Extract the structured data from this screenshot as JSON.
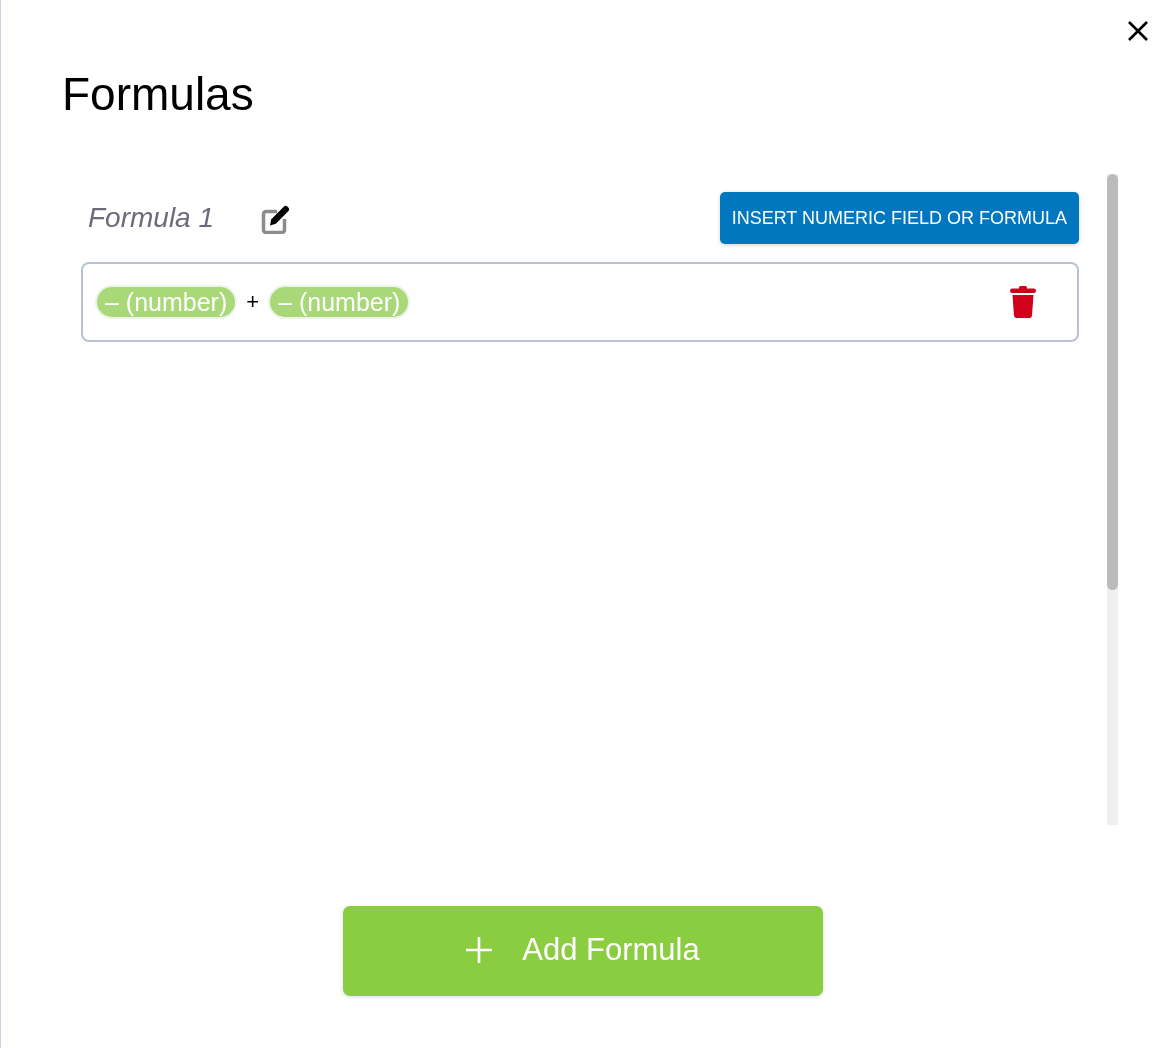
{
  "dialog": {
    "title": "Formulas",
    "formulas": [
      {
        "name": "Formula 1",
        "insert_button": "INSERT NUMERIC FIELD OR FORMULA",
        "tokens": [
          {
            "kind": "chip",
            "text": "– (number)"
          },
          {
            "kind": "operator",
            "text": "+"
          },
          {
            "kind": "chip",
            "text": "– (number)"
          }
        ]
      }
    ],
    "add_button": "Add Formula"
  }
}
